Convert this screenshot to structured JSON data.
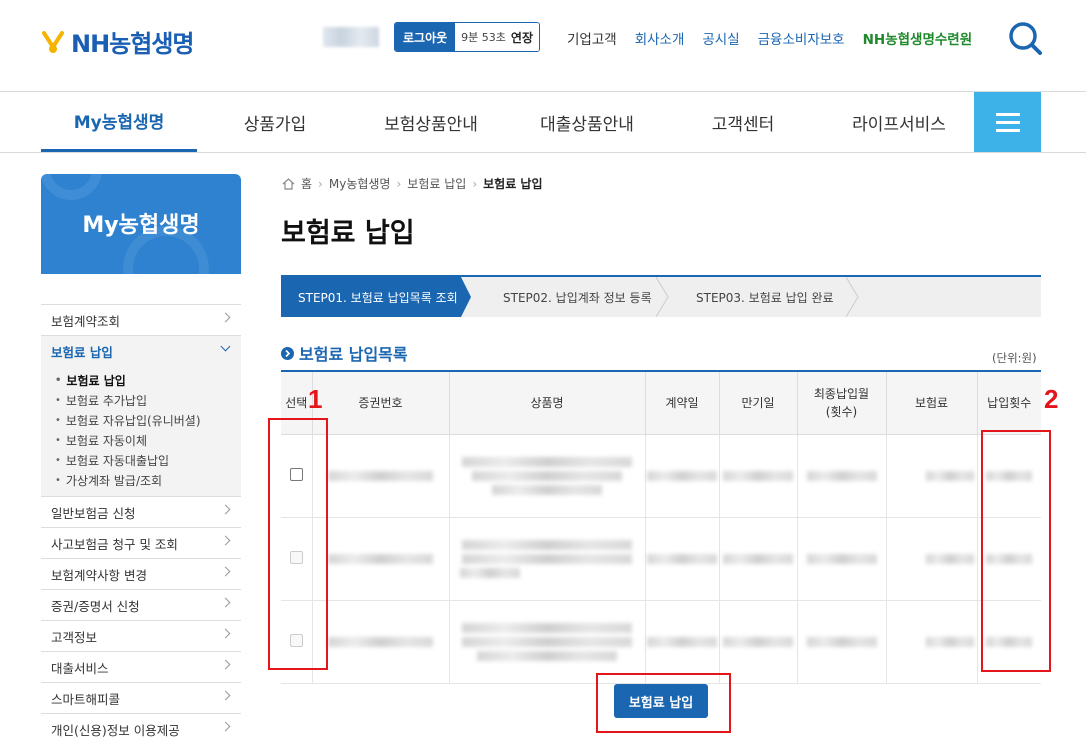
{
  "header": {
    "logo_text": "NH농협생명",
    "logout_label": "로그아웃",
    "session_time": "9분 53초",
    "extend_label": "연장",
    "util_links": [
      {
        "label": "기업고객",
        "style": "plain"
      },
      {
        "label": "회사소개",
        "style": "blue"
      },
      {
        "label": "공시실",
        "style": "blue"
      },
      {
        "label": "금융소비자보호",
        "style": "blue"
      },
      {
        "label": "NH농협생명수련원",
        "style": "green"
      }
    ]
  },
  "gnb": {
    "items": [
      "My농협생명",
      "상품가입",
      "보험상품안내",
      "대출상품안내",
      "고객센터",
      "라이프서비스"
    ],
    "active_index": 0
  },
  "sidebar": {
    "banner_title": "My농협생명",
    "items": [
      {
        "label": "보험계약조회"
      },
      {
        "label": "보험료 납입",
        "open": true
      },
      {
        "label": "일반보험금 신청"
      },
      {
        "label": "사고보험금 청구 및 조회"
      },
      {
        "label": "보험계약사항 변경"
      },
      {
        "label": "증권/증명서 신청"
      },
      {
        "label": "고객정보"
      },
      {
        "label": "대출서비스"
      },
      {
        "label": "스마트해피콜"
      },
      {
        "label": "개인(신용)정보 이용제공"
      }
    ],
    "sub_items": [
      "보험료 납입",
      "보험료 추가납입",
      "보험료 자유납입(유니버셜)",
      "보험료 자동이체",
      "보험료 자동대출납입",
      "가상계좌 발급/조회"
    ],
    "sub_current": 0
  },
  "breadcrumb": [
    "홈",
    "My농협생명",
    "보험료 납입",
    "보험료 납입"
  ],
  "page_title": "보험료 납입",
  "steps": [
    "STEP01.  보험료 납입목록 조회",
    "STEP02.  납입계좌 정보 등록",
    "STEP03.  보험료 납입 완료"
  ],
  "section_title": "보험료 납입목록",
  "unit_label": "(단위:원)",
  "table": {
    "headers": [
      "선택",
      "증권번호",
      "상품명",
      "계약일",
      "만기일",
      "최종납입월\n(횟수)",
      "보험료",
      "납입횟수"
    ],
    "rows": [
      {
        "checkbox_enabled": true
      },
      {
        "checkbox_enabled": false
      },
      {
        "checkbox_enabled": false
      }
    ]
  },
  "pay_button_label": "보험료 납입",
  "annotations": [
    "1",
    "2"
  ],
  "colors": {
    "primary": "#1b66b1",
    "sky": "#3db2e8",
    "annotation": "#e3161c",
    "green": "#1f8a2c"
  },
  "icons": [
    "logo-mark-icon",
    "search-icon",
    "menu-icon",
    "home-icon",
    "circle-arrow-icon",
    "chevron-right-icon",
    "chevron-down-icon"
  ]
}
